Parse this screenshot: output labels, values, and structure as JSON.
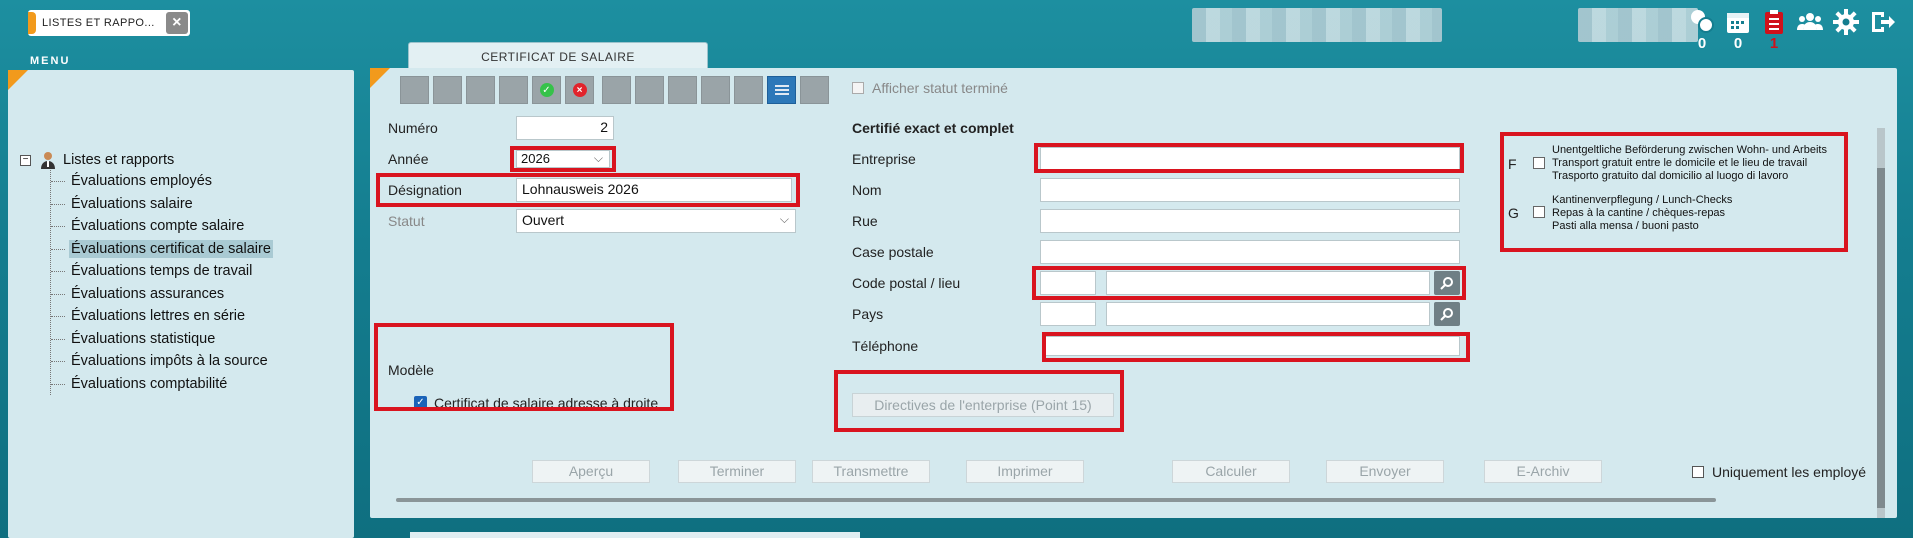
{
  "header": {
    "app_tab_label": "LISTES ET RAPPO...",
    "menu_label": "MENU",
    "icons": [
      {
        "name": "chat-icon",
        "count": "0"
      },
      {
        "name": "calendar-icon",
        "count": "0"
      },
      {
        "name": "clipboard-icon",
        "count": "1"
      },
      {
        "name": "users-icon",
        "count": ""
      },
      {
        "name": "gear-icon",
        "count": ""
      },
      {
        "name": "logout-icon",
        "count": ""
      }
    ]
  },
  "sidebar": {
    "root": "Listes et rapports",
    "items": [
      "Évaluations employés",
      "Évaluations salaire",
      "Évaluations compte salaire",
      "Évaluations certificat de salaire",
      "Évaluations temps de travail",
      "Évaluations assurances",
      "Évaluations lettres en série",
      "Évaluations statistique",
      "Évaluations impôts à la source",
      "Évaluations comptabilité"
    ],
    "selected_index": 3
  },
  "document": {
    "tab_title": "CERTIFICAT DE SALAIRE",
    "status_checkbox_label": "Afficher statut terminé"
  },
  "form": {
    "numero_label": "Numéro",
    "numero_value": "2",
    "annee_label": "Année",
    "annee_value": "2026",
    "designation_label": "Désignation",
    "designation_value": "Lohnausweis  2026",
    "statut_label": "Statut",
    "statut_value": "Ouvert",
    "modele_label": "Modèle",
    "modele_option": "Certificat de salaire adresse à droite"
  },
  "company": {
    "section_title": "Certifié exact et complet",
    "entreprise_label": "Entreprise",
    "nom_label": "Nom",
    "rue_label": "Rue",
    "case_postale_label": "Case postale",
    "code_postal_label": "Code postal / lieu",
    "pays_label": "Pays",
    "telephone_label": "Téléphone",
    "directives_button": "Directives de l'enterprise (Point 15)"
  },
  "options": {
    "f_letter": "F",
    "f_lines": [
      "Unentgeltliche Beförderung zwischen Wohn- und Arbeits",
      "Transport gratuit entre le domicile et le lieu de travail",
      "Trasporto gratuito dal domicilio al luogo di lavoro"
    ],
    "g_letter": "G",
    "g_lines": [
      "Kantinenverpflegung / Lunch-Checks",
      "Repas à la cantine / chèques-repas",
      "Pasti alla mensa / buoni pasto"
    ]
  },
  "actions": {
    "apercu": "Aperçu",
    "terminer": "Terminer",
    "transmettre": "Transmettre",
    "imprimer": "Imprimer",
    "calculer": "Calculer",
    "envoyer": "Envoyer",
    "earchiv": "E-Archiv",
    "uniquement": "Uniquement les employé"
  },
  "colors": {
    "accent_orange": "#f29a1c",
    "highlight_red": "#d9141f",
    "panel_bg": "#d4e9ee"
  }
}
